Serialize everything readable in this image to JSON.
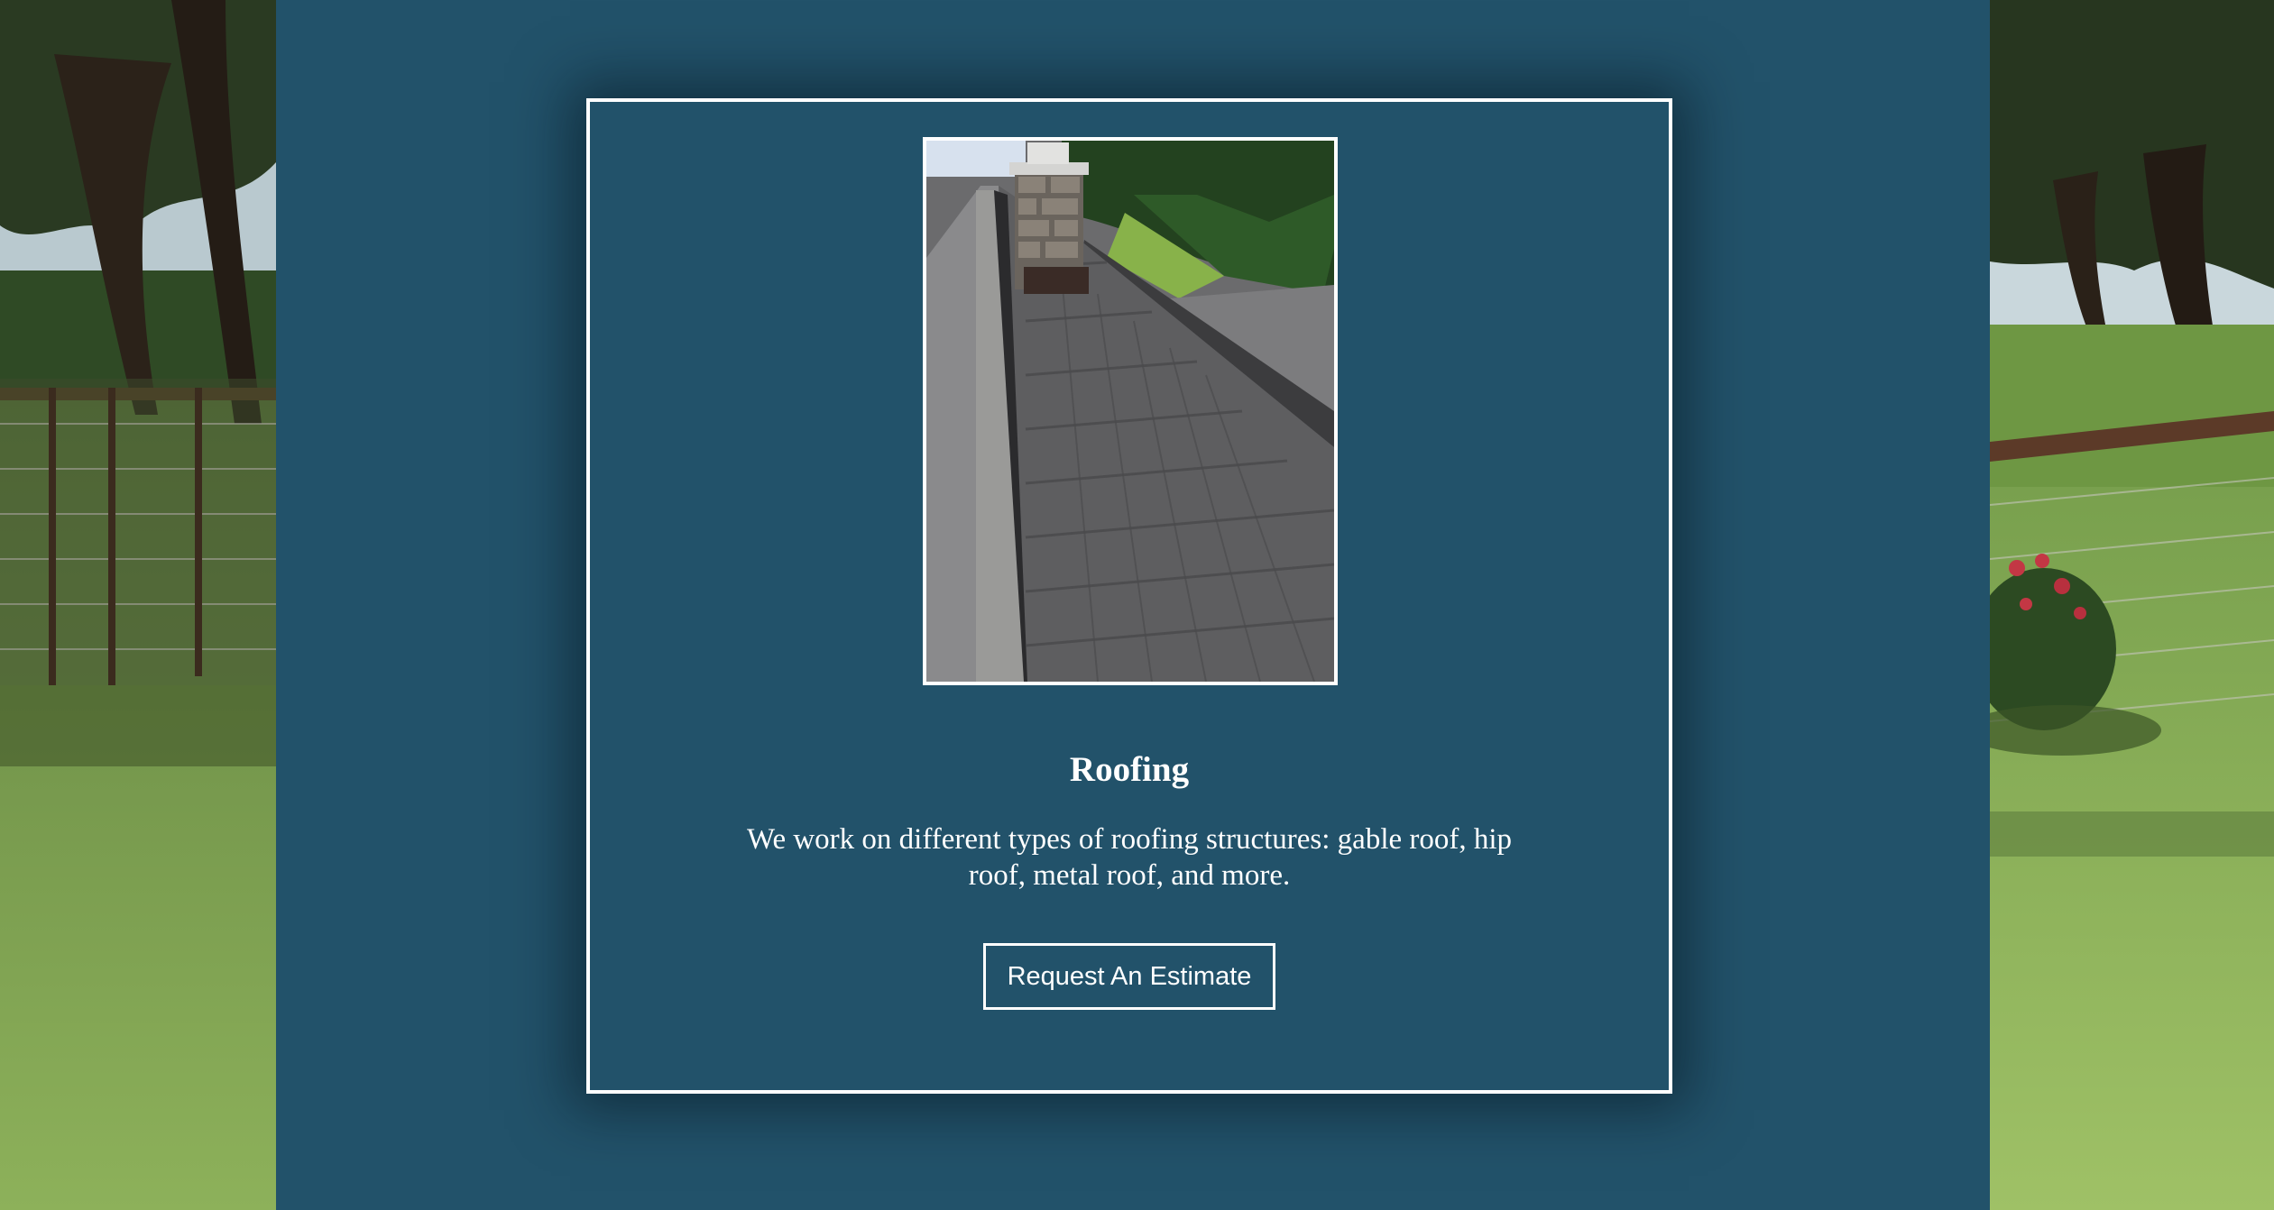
{
  "service": {
    "title": "Roofing",
    "description": "We work on different types of roofing structures: gable roof, hip roof, metal roof, and more.",
    "cta_label": "Request An Estimate"
  },
  "colors": {
    "panel_background": "#22526a",
    "card_border": "#ffffff",
    "text": "#ffffff"
  },
  "images": {
    "service_photo": "roof-shingles-photo",
    "background": "pasture-fence-trees-photo"
  }
}
